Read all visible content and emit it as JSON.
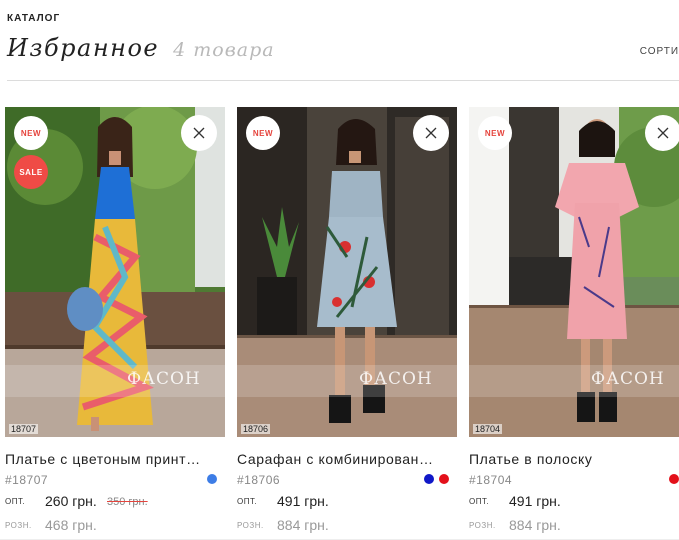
{
  "breadcrumb": "КАТАЛОГ",
  "page": {
    "title": "Избранное",
    "count": "4 товара",
    "sort_label": "СОРТИ"
  },
  "colors": {
    "accent": "#e5443d",
    "muted": "#b9b9b9"
  },
  "products": [
    {
      "badges": {
        "new": "NEW",
        "sale": "SALE"
      },
      "watermark": "ФАСОН",
      "photo_code": "18707",
      "name": "Платье с цветоным принт…",
      "sku": "#18707",
      "colors": [
        "#3d7de6"
      ],
      "wholesale_label": "ОПТ.",
      "wholesale_price": "260 грн.",
      "old_price": "350 грн.",
      "retail_label": "РОЗН.",
      "retail_price": "468 грн."
    },
    {
      "badges": {
        "new": "NEW"
      },
      "watermark": "ФАСОН",
      "photo_code": "18706",
      "name": "Сарафан с комбинирован…",
      "sku": "#18706",
      "colors": [
        "#1018c8",
        "#e3101a"
      ],
      "wholesale_label": "ОПТ.",
      "wholesale_price": "491 грн.",
      "retail_label": "РОЗН.",
      "retail_price": "884 грн."
    },
    {
      "badges": {
        "new": "NEW"
      },
      "watermark": "ФАСОН",
      "photo_code": "18704",
      "name": "Платье в полоску",
      "sku": "#18704",
      "colors": [
        "#e3101a"
      ],
      "wholesale_label": "ОПТ.",
      "wholesale_price": "491 грн.",
      "retail_label": "РОЗН.",
      "retail_price": "884 грн."
    }
  ]
}
